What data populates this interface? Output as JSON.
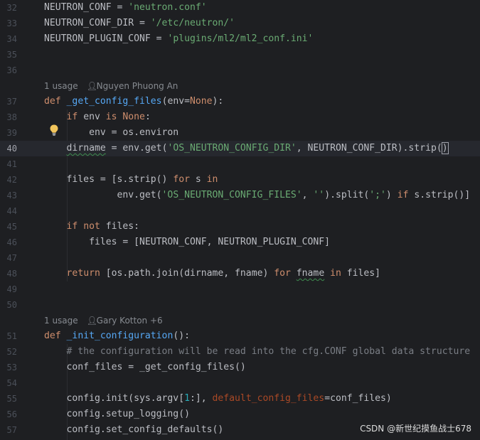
{
  "editor": {
    "lines": {
      "l32": {
        "num": "32",
        "t1": "NEUTRON_CONF = ",
        "t2": "'neutron.conf'"
      },
      "l33": {
        "num": "33",
        "t1": "NEUTRON_CONF_DIR = ",
        "t2": "'/etc/neutron/'"
      },
      "l34": {
        "num": "34",
        "t1": "NEUTRON_PLUGIN_CONF = ",
        "t2": "'plugins/ml2/ml2_conf.ini'"
      },
      "l35": {
        "num": "35"
      },
      "l36": {
        "num": "36"
      },
      "l37": {
        "num": "37",
        "k1": "def ",
        "f1": "_get_config_files",
        "t1": "(env=",
        "k2": "None",
        "t2": "):"
      },
      "l38": {
        "num": "38",
        "i": "    ",
        "k1": "if ",
        "t1": "env ",
        "k2": "is None",
        "t2": ":"
      },
      "l39": {
        "num": "39",
        "t1": "        env = os.environ"
      },
      "l40": {
        "num": "40",
        "i": "    ",
        "s1": "dirname",
        "t1": " = env.get(",
        "str1": "'OS_NEUTRON_CONFIG_DIR'",
        "t2": ", NEUTRON_CONF_DIR).strip(",
        "t3": ")"
      },
      "l41": {
        "num": "41"
      },
      "l42": {
        "num": "42",
        "t1": "    files = [s.strip() ",
        "k1": "for ",
        "t2": "s ",
        "k2": "in"
      },
      "l43": {
        "num": "43",
        "t1": "             env.get(",
        "str1": "'OS_NEUTRON_CONFIG_FILES'",
        "t2": ", ",
        "str2": "''",
        "t3": ").split(",
        "str3": "';'",
        "t4": ") ",
        "k1": "if ",
        "t5": "s.strip()]"
      },
      "l44": {
        "num": "44"
      },
      "l45": {
        "num": "45",
        "i": "    ",
        "k1": "if not ",
        "t1": "files:"
      },
      "l46": {
        "num": "46",
        "t1": "        files = [NEUTRON_CONF, NEUTRON_PLUGIN_CONF]"
      },
      "l47": {
        "num": "47"
      },
      "l48": {
        "num": "48",
        "i": "    ",
        "k1": "return ",
        "t1": "[os.path.join(dirname, fname) ",
        "k2": "for ",
        "s1": "fname",
        "t2": " ",
        "k3": "in ",
        "t3": "files]"
      },
      "l49": {
        "num": "49"
      },
      "l50": {
        "num": "50"
      },
      "l51": {
        "num": "51",
        "k1": "def ",
        "f1": "_init_configuration",
        "t1": "():"
      },
      "l52": {
        "num": "52",
        "c1": "    # the configuration will be read into the cfg.CONF global data structure"
      },
      "l53": {
        "num": "53",
        "t1": "    conf_files = _get_config_files()"
      },
      "l54": {
        "num": "54"
      },
      "l55": {
        "num": "55",
        "t1": "    config.init(sys.argv[",
        "n1": "1",
        "t2": ":], ",
        "p1": "default_config_files",
        "t3": "=conf_files)"
      },
      "l56": {
        "num": "56",
        "t1": "    config.setup_logging()"
      },
      "l57": {
        "num": "57",
        "t1": "    config.set_config_defaults()"
      }
    },
    "hints": {
      "h1": {
        "usage": "1 usage",
        "author": "Nguyen Phuong An"
      },
      "h2": {
        "usage": "1 usage",
        "author": "Gary Kotton +6"
      }
    }
  },
  "watermark": "CSDN @新世纪摸鱼战士678"
}
